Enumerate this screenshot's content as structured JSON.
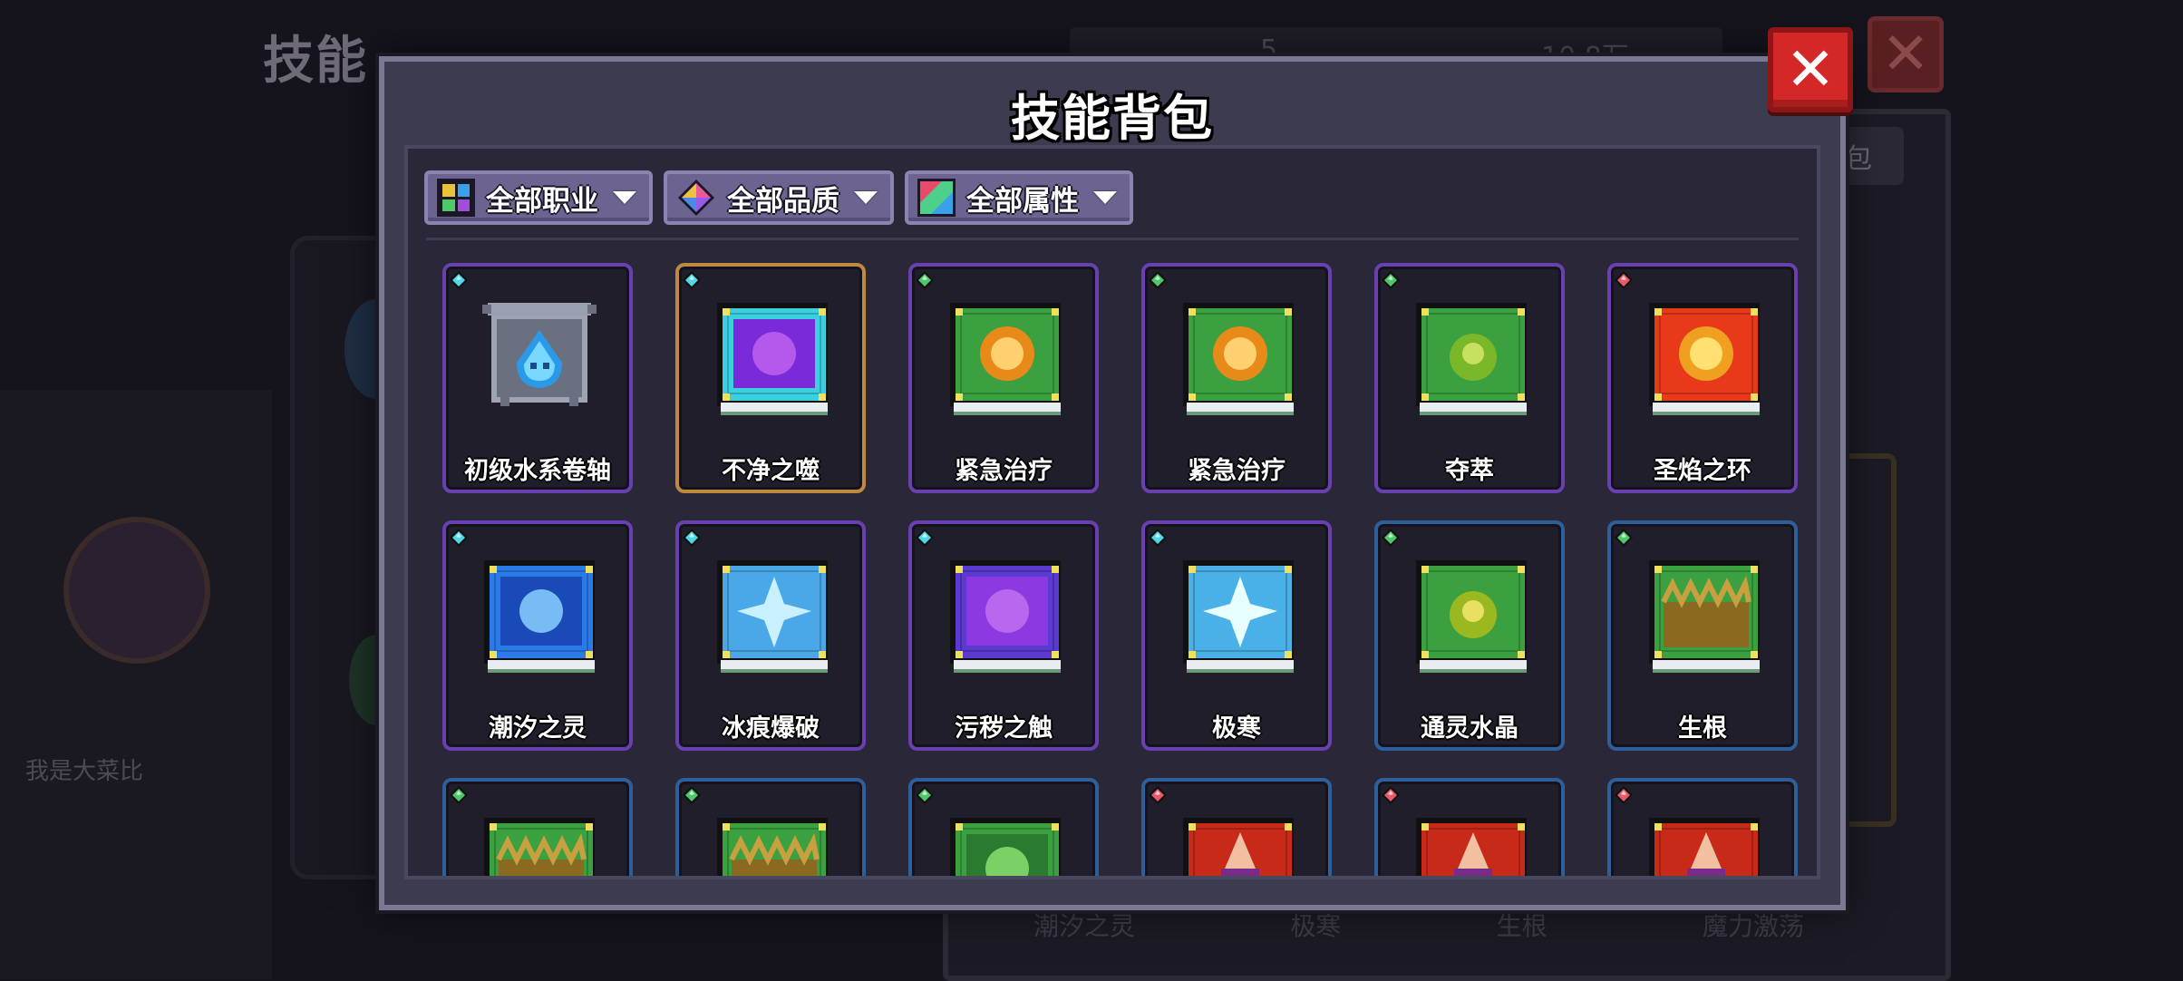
{
  "background": {
    "screen_title": "技能",
    "tab_label": "包",
    "top_num_1": "5",
    "top_num_2": "10.8万",
    "player_name": "我是大菜比",
    "bottom_labels": [
      "潮汐之灵",
      "极寒",
      "生根",
      "魔力激荡"
    ]
  },
  "modal": {
    "title": "技能背包",
    "close_label": "✕",
    "filters": [
      {
        "label": "全部职业",
        "icon": "class-grid-icon"
      },
      {
        "label": "全部品质",
        "icon": "quality-gem-icon"
      },
      {
        "label": "全部属性",
        "icon": "attribute-prism-icon"
      }
    ]
  },
  "colors": {
    "gem_water": "#4fd8e8",
    "gem_nature": "#4ec86a",
    "gem_fire": "#e85a6a",
    "border_epic": "#6a3fb0",
    "border_rare": "#2f5f9a",
    "border_selected": "#c08a3e",
    "close_red": "#d42828"
  },
  "skills": [
    {
      "name": "初级水系卷轴",
      "element": "water",
      "rarity": "epic",
      "icon": "water-scroll-icon",
      "selected": false
    },
    {
      "name": "不净之噬",
      "element": "water",
      "rarity": "epic",
      "icon": "purple-bite-book-icon",
      "selected": true
    },
    {
      "name": "紧急治疗",
      "element": "nature",
      "rarity": "epic",
      "icon": "heal-orb-book-icon",
      "selected": false
    },
    {
      "name": "紧急治疗",
      "element": "nature",
      "rarity": "epic",
      "icon": "heal-orb-book-icon",
      "selected": false
    },
    {
      "name": "夺萃",
      "element": "nature",
      "rarity": "epic",
      "icon": "seed-book-icon",
      "selected": false
    },
    {
      "name": "圣焰之环",
      "element": "fire",
      "rarity": "epic",
      "icon": "holy-flame-book-icon",
      "selected": false
    },
    {
      "name": "潮汐之灵",
      "element": "water",
      "rarity": "epic",
      "icon": "tide-book-icon",
      "selected": false
    },
    {
      "name": "冰痕爆破",
      "element": "water",
      "rarity": "epic",
      "icon": "ice-burst-book-icon",
      "selected": false
    },
    {
      "name": "污秽之触",
      "element": "water",
      "rarity": "epic",
      "icon": "filth-book-icon",
      "selected": false
    },
    {
      "name": "极寒",
      "element": "water",
      "rarity": "epic",
      "icon": "frost-book-icon",
      "selected": false
    },
    {
      "name": "通灵水晶",
      "element": "nature",
      "rarity": "rare",
      "icon": "spirit-crystal-book-icon",
      "selected": false
    },
    {
      "name": "生根",
      "element": "nature",
      "rarity": "rare",
      "icon": "root-book-icon",
      "selected": false
    },
    {
      "name": "",
      "element": "nature",
      "rarity": "rare",
      "icon": "grass-book-icon",
      "selected": false
    },
    {
      "name": "",
      "element": "nature",
      "rarity": "rare",
      "icon": "grass-book-icon",
      "selected": false
    },
    {
      "name": "",
      "element": "nature",
      "rarity": "rare",
      "icon": "leaf-book-icon",
      "selected": false
    },
    {
      "name": "",
      "element": "fire",
      "rarity": "rare",
      "icon": "fire-mage-book-icon",
      "selected": false
    },
    {
      "name": "",
      "element": "fire",
      "rarity": "rare",
      "icon": "fire-mage-book-icon",
      "selected": false
    },
    {
      "name": "",
      "element": "fire",
      "rarity": "rare",
      "icon": "fire-mage-book-icon",
      "selected": false
    }
  ]
}
